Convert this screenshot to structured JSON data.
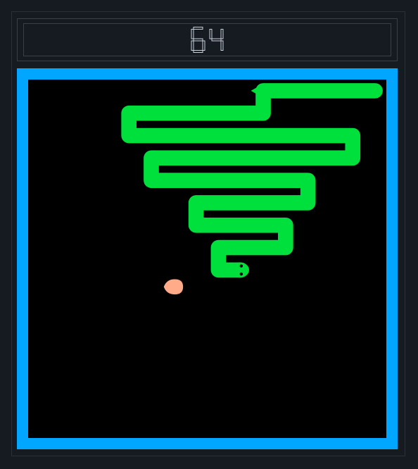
{
  "score": {
    "value": "64"
  },
  "colors": {
    "background": "#161b22",
    "border": "#00a6ff",
    "field": "#000000",
    "snake": "#00e03c",
    "food": "#ffaa88",
    "digits": "#c9d1d9"
  },
  "game": {
    "grid_cols": 16,
    "grid_rows": 16,
    "snake_path": [
      [
        15,
        0
      ],
      [
        10,
        0
      ],
      [
        10,
        1
      ],
      [
        4,
        1
      ],
      [
        4,
        2
      ],
      [
        14,
        2
      ],
      [
        14,
        3
      ],
      [
        5,
        3
      ],
      [
        5,
        4
      ],
      [
        12,
        4
      ],
      [
        12,
        5
      ],
      [
        7,
        5
      ],
      [
        7,
        6
      ],
      [
        11,
        6
      ],
      [
        11,
        7
      ],
      [
        8,
        7
      ],
      [
        8,
        8
      ],
      [
        9,
        8
      ]
    ],
    "tail_cell": [
      10,
      0
    ],
    "head_cell": [
      9,
      8
    ],
    "head_direction": "right",
    "food_cell": [
      6,
      9
    ]
  }
}
